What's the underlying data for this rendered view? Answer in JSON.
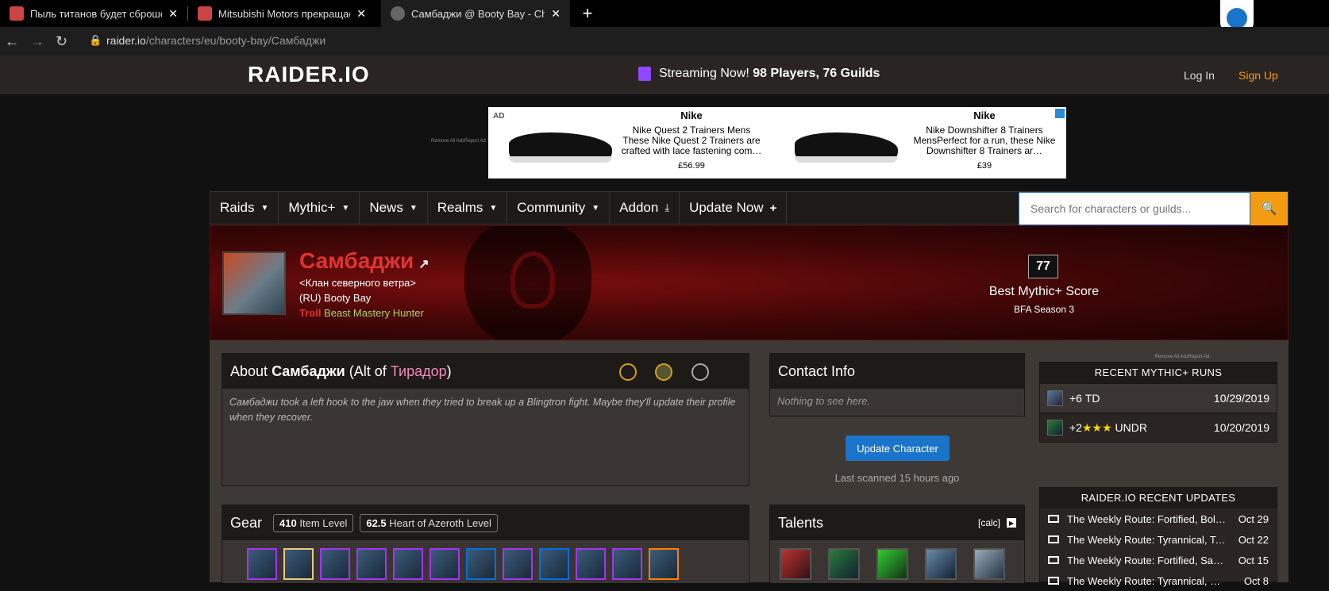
{
  "browser": {
    "tabs": [
      {
        "title": "Пыль титанов будет сброшена с"
      },
      {
        "title": "Mitsubishi Motors прекращает с"
      },
      {
        "title": "Самбаджи @ Booty Bay - Charac"
      }
    ],
    "url_domain": "raider.io",
    "url_path": "/characters/eu/booty-bay/Самбаджи"
  },
  "header": {
    "logo_text": "RAIDER.IO",
    "streaming_prefix": "Streaming Now!",
    "streaming_counts": "98 Players, 76 Guilds",
    "login": "Log In",
    "signup": "Sign Up"
  },
  "ad": {
    "label": "AD",
    "remove_text": "Remove All AdsReport Ad",
    "products": [
      {
        "brand": "Nike",
        "desc": "Nike Quest 2 Trainers Mens These Nike Quest 2 Trainers are crafted with lace fastening com…",
        "price": "£56.99"
      },
      {
        "brand": "Nike",
        "desc": "Nike Downshifter 8 Trainers MensPerfect for a run, these Nike Downshifter 8 Trainers ar…",
        "price": "£39"
      }
    ]
  },
  "nav": {
    "items": [
      "Raids",
      "Mythic+",
      "News",
      "Realms",
      "Community",
      "Addon",
      "Update Now"
    ],
    "search_placeholder": "Search for characters or guilds..."
  },
  "character": {
    "name": "Самбаджи",
    "guild": "<Клан северного ветра>",
    "realm": "(RU) Booty Bay",
    "race": "Troll",
    "class": "Beast Mastery Hunter",
    "score": "77",
    "score_label": "Best Mythic+ Score",
    "season": "BFA Season 3"
  },
  "about": {
    "prefix": "About",
    "name": "Самбаджи",
    "alt_of_prefix": "(Alt of",
    "alt_name": "Тирадор",
    "alt_suffix": ")",
    "body": "Самбаджи took a left hook to the jaw when they tried to break up a Blingtron fight. Maybe they'll update their profile when they recover."
  },
  "contact": {
    "title": "Contact Info",
    "body": "Nothing to see here."
  },
  "update": {
    "button": "Update Character",
    "scanned": "Last scanned 15 hours ago"
  },
  "gear": {
    "title": "Gear",
    "item_level_value": "410",
    "item_level_label": "Item Level",
    "hoa_value": "62.5",
    "hoa_label": "Heart of Azeroth Level"
  },
  "talents": {
    "title": "Talents",
    "calc": "[calc]"
  },
  "sidebar": {
    "ad_remove": "Remove All AdsReport Ad",
    "runs_title": "RECENT MYTHIC+ RUNS",
    "runs": [
      {
        "level": "+6",
        "stars": "",
        "dungeon": "TD",
        "date": "10/29/2019"
      },
      {
        "level": "+2",
        "stars": "★★★",
        "dungeon": "UNDR",
        "date": "10/20/2019"
      }
    ],
    "updates_title": "RAIDER.IO RECENT UPDATES",
    "updates": [
      {
        "title": "The Weekly Route: Fortified, Bols…",
        "date": "Oct 29"
      },
      {
        "title": "The Weekly Route: Tyrannical, Te…",
        "date": "Oct 22"
      },
      {
        "title": "The Weekly Route: Fortified, San…",
        "date": "Oct 15"
      },
      {
        "title": "The Weekly Route: Tyrannical, Ra…",
        "date": "Oct 8"
      }
    ]
  }
}
